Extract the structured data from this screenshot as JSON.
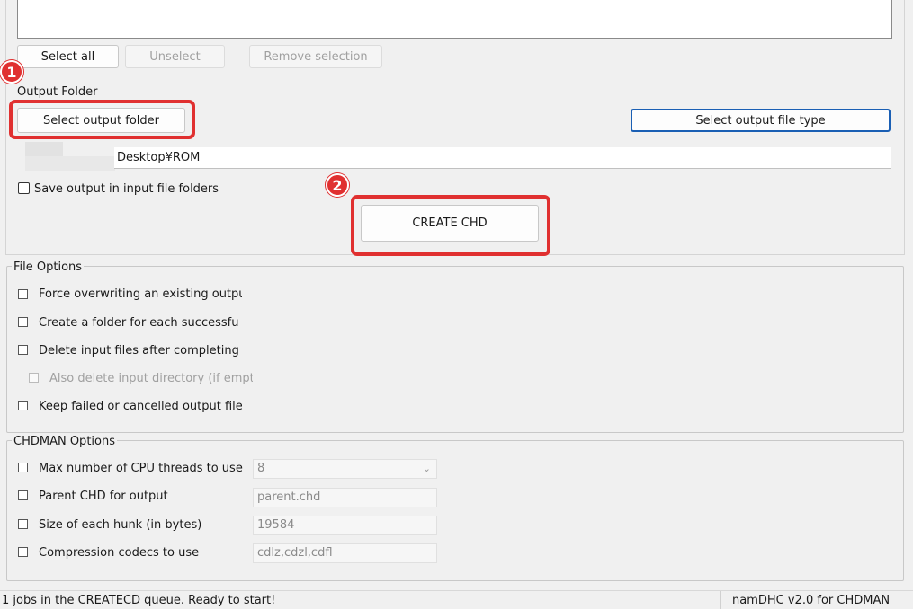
{
  "buttons": {
    "select_all": "Select all",
    "unselect": "Unselect",
    "remove_selection": "Remove selection",
    "select_output_folder": "Select output folder",
    "select_output_file_type": "Select output file type",
    "create_chd": "CREATE CHD"
  },
  "output": {
    "folder_label": "Output Folder",
    "path": "Desktop¥ROM",
    "save_in_input_label": "Save output in input file folders"
  },
  "annotations": {
    "step1": "1",
    "step2": "2",
    "color": "#e03030"
  },
  "file_options": {
    "title": "File Options",
    "items": [
      "Force overwriting an existing outpu",
      "Create a folder for each successfu",
      "Delete input files after completing j",
      "Also delete input directory (if empty",
      "Keep failed or cancelled output files"
    ]
  },
  "chdman_options": {
    "title": "CHDMAN Options",
    "cpu_threads_label": "Max number of CPU threads to use",
    "cpu_threads_value": "8",
    "parent_chd_label": "Parent CHD for output",
    "parent_chd_value": "parent.chd",
    "hunk_size_label": "Size of each hunk (in bytes)",
    "hunk_size_value": "19584",
    "codecs_label": "Compression codecs to use",
    "codecs_value": "cdlz,cdzl,cdfl"
  },
  "status": {
    "left": "1  jobs in the CREATECD queue. Ready to start!",
    "right": "namDHC v2.0 for CHDMAN"
  }
}
